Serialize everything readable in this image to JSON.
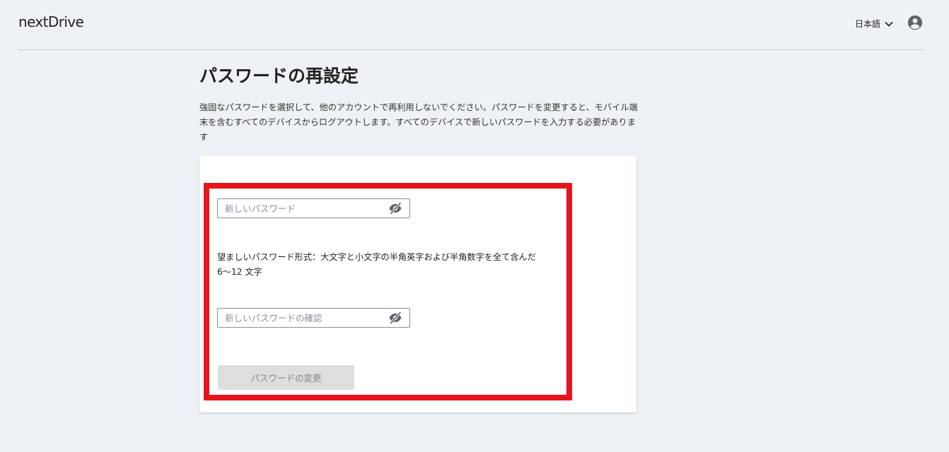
{
  "header": {
    "logo_text": "nextDrive",
    "language_label": "日本語"
  },
  "main": {
    "title": "パスワードの再設定",
    "description": "強固なパスワードを選択して、他のアカウントで再利用しないでください。パスワードを変更すると、モバイル端末を含むすべてのデバイスからログアウトします。すべてのデバイスで新しいパスワードを入力する必要があります"
  },
  "form": {
    "new_password": {
      "placeholder": "新しいパスワード",
      "value": ""
    },
    "hint": "望ましいパスワード形式：大文字と小文字の半角英字および半角数字を全て含んだ 6〜12 文字",
    "confirm_password": {
      "placeholder": "新しいパスワードの確認",
      "value": ""
    },
    "submit_label": "パスワードの変更"
  },
  "colors": {
    "background": "#eef1f5",
    "highlight_border": "#e8141c",
    "disabled_button_bg": "#dedede",
    "disabled_button_text": "#a3a3a3"
  },
  "icons": {
    "language_dropdown": "chevron-down-icon",
    "account": "account-circle-icon",
    "password_visibility": "eye-off-icon"
  }
}
